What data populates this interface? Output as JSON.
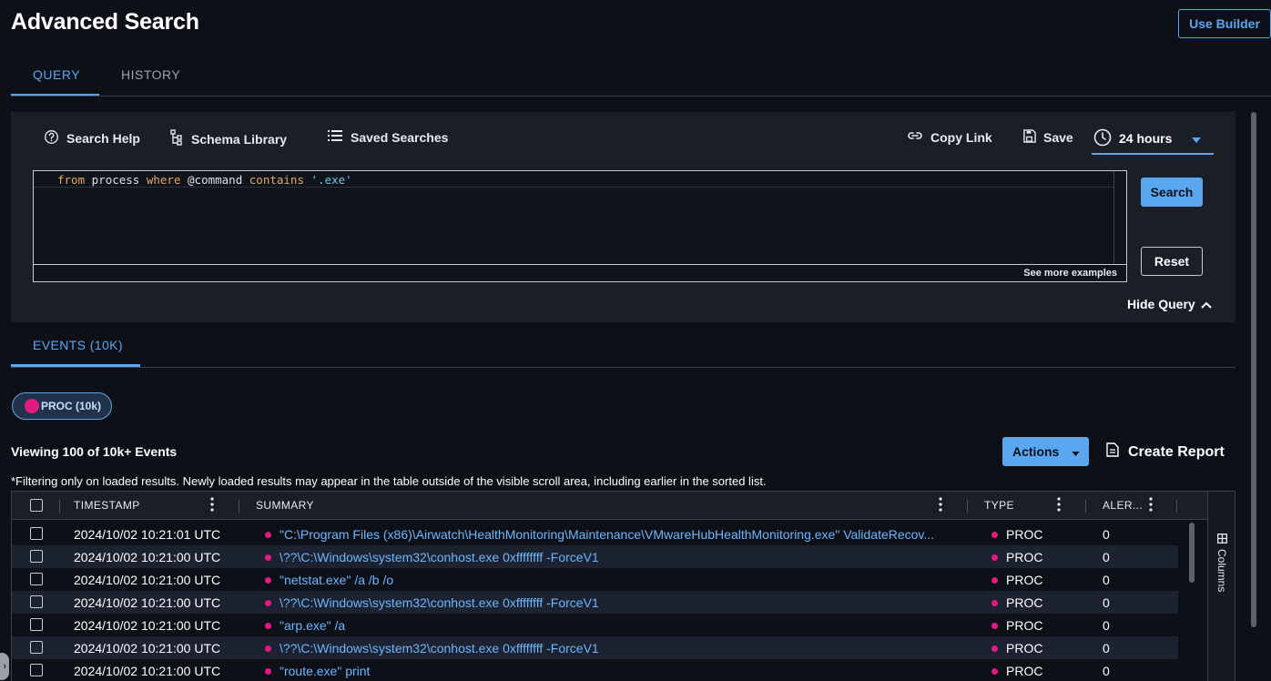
{
  "header": {
    "title": "Advanced Search",
    "use_builder_label": "Use Builder"
  },
  "tabs": [
    {
      "label": "QUERY",
      "active": true
    },
    {
      "label": "HISTORY",
      "active": false
    }
  ],
  "toolbar": {
    "search_help": "Search Help",
    "schema_library": "Schema Library",
    "saved_searches": "Saved Searches",
    "copy_link": "Copy Link",
    "save": "Save",
    "time_range": "24 hours"
  },
  "query": {
    "keyword_from": "from",
    "entity": "process",
    "keyword_where": "where",
    "field": "@command",
    "operator": "contains",
    "value": "'.exe'",
    "see_more": "See more examples"
  },
  "buttons": {
    "search": "Search",
    "reset": "Reset",
    "hide_query": "Hide Query",
    "actions": "Actions",
    "create_report": "Create Report"
  },
  "events_tab": "EVENTS (10K)",
  "chip": {
    "label": "PROC (10k)",
    "color": "#e01b84"
  },
  "viewing": "Viewing 100 of 10k+ Events",
  "filter_note": "*Filtering only on loaded results.  Newly loaded results may appear in the table outside of the visible scroll area, including earlier in the sorted list.",
  "table": {
    "columns": [
      "TIMESTAMP",
      "SUMMARY",
      "TYPE",
      "ALER..."
    ],
    "rows": [
      {
        "timestamp": "2024/10/02 10:21:01 UTC",
        "summary": "\"C:\\Program Files (x86)\\Airwatch\\HealthMonitoring\\Maintenance\\VMwareHubHealthMonitoring.exe\" ValidateRecov...",
        "type": "PROC",
        "alerts": "0"
      },
      {
        "timestamp": "2024/10/02 10:21:00 UTC",
        "summary": "\\??\\C:\\Windows\\system32\\conhost.exe 0xffffffff -ForceV1",
        "type": "PROC",
        "alerts": "0"
      },
      {
        "timestamp": "2024/10/02 10:21:00 UTC",
        "summary": "\"netstat.exe\" /a /b /o",
        "type": "PROC",
        "alerts": "0"
      },
      {
        "timestamp": "2024/10/02 10:21:00 UTC",
        "summary": "\\??\\C:\\Windows\\system32\\conhost.exe 0xffffffff -ForceV1",
        "type": "PROC",
        "alerts": "0"
      },
      {
        "timestamp": "2024/10/02 10:21:00 UTC",
        "summary": "\"arp.exe\" /a",
        "type": "PROC",
        "alerts": "0"
      },
      {
        "timestamp": "2024/10/02 10:21:00 UTC",
        "summary": "\\??\\C:\\Windows\\system32\\conhost.exe 0xffffffff -ForceV1",
        "type": "PROC",
        "alerts": "0"
      },
      {
        "timestamp": "2024/10/02 10:21:00 UTC",
        "summary": "\"route.exe\" print",
        "type": "PROC",
        "alerts": "0"
      }
    ],
    "columns_panel_label": "Columns"
  },
  "colors": {
    "accent": "#5aa6f0",
    "proc_dot": "#e01b84",
    "background": "#0d1117"
  }
}
